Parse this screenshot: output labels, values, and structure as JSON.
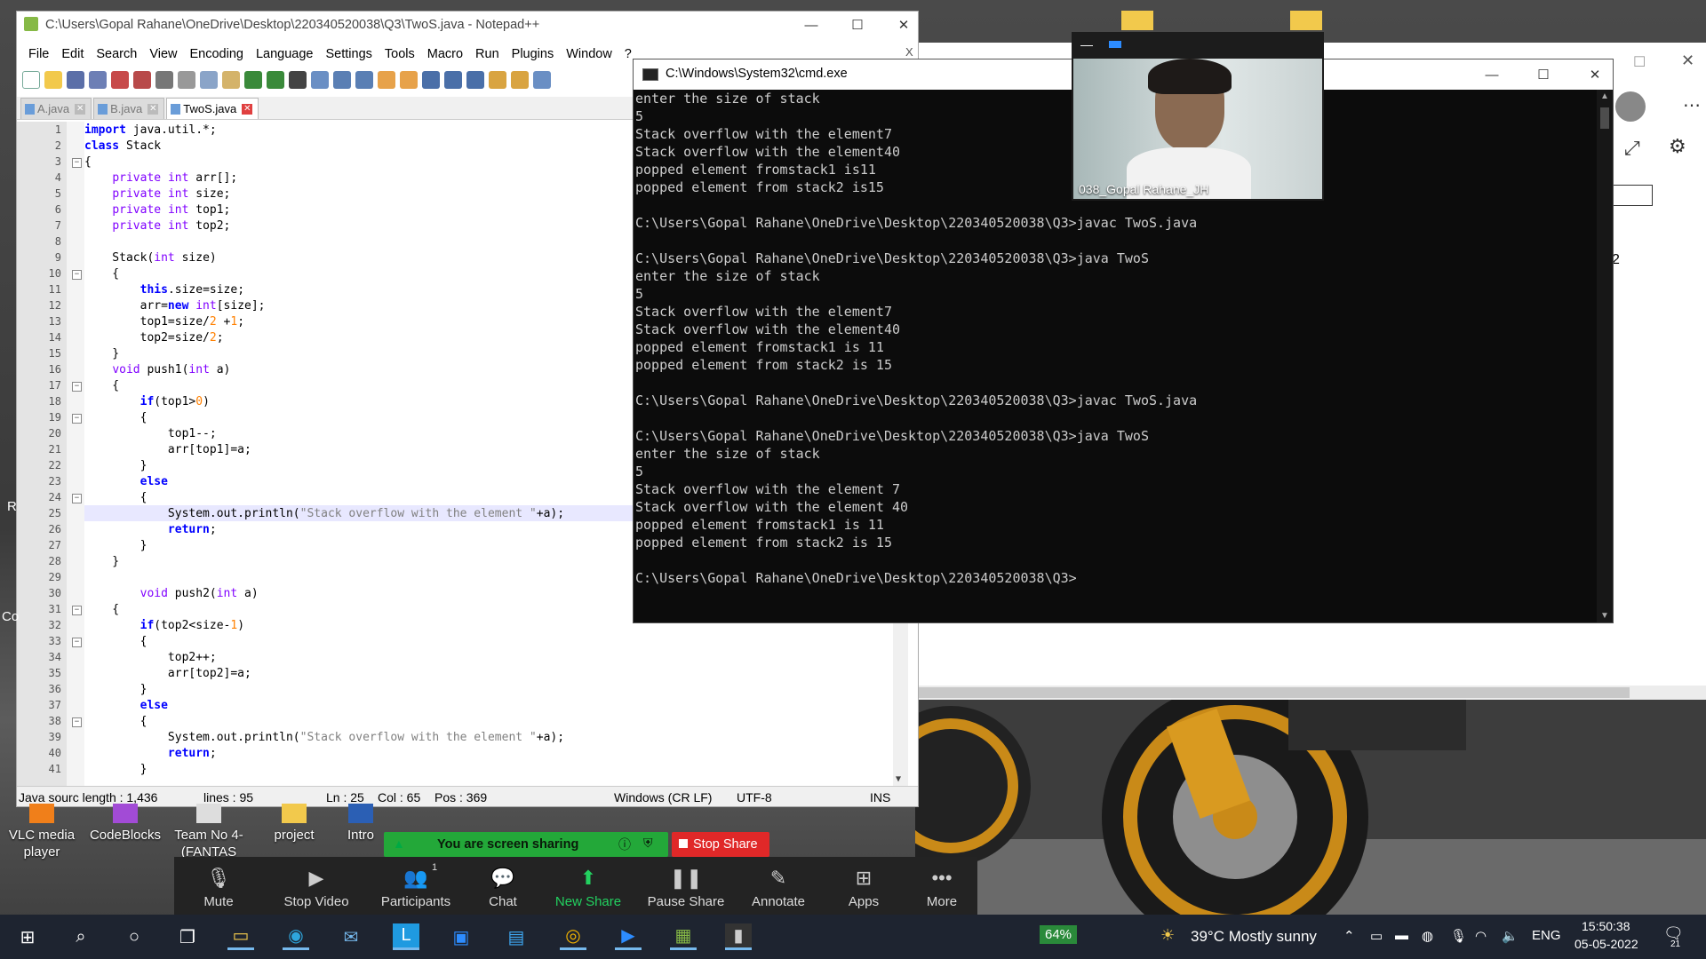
{
  "npp": {
    "title": "C:\\Users\\Gopal Rahane\\OneDrive\\Desktop\\220340520038\\Q3\\TwoS.java - Notepad++",
    "menu": [
      "File",
      "Edit",
      "Search",
      "View",
      "Encoding",
      "Language",
      "Settings",
      "Tools",
      "Macro",
      "Run",
      "Plugins",
      "Window",
      "?"
    ],
    "close_x": "X",
    "tabs": [
      "A.java",
      "B.java",
      "TwoS.java"
    ],
    "lines": [
      {
        "n": "1",
        "html": "<span class='kw'>import</span> java.util.*;"
      },
      {
        "n": "2",
        "html": "<span class='kw'>class</span> Stack"
      },
      {
        "n": "3",
        "html": "{"
      },
      {
        "n": "4",
        "html": "    <span class='ty'>private</span> <span class='ty'>int</span> arr[];"
      },
      {
        "n": "5",
        "html": "    <span class='ty'>private</span> <span class='ty'>int</span> size;"
      },
      {
        "n": "6",
        "html": "    <span class='ty'>private</span> <span class='ty'>int</span> top1;"
      },
      {
        "n": "7",
        "html": "    <span class='ty'>private</span> <span class='ty'>int</span> top2;"
      },
      {
        "n": "8",
        "html": ""
      },
      {
        "n": "9",
        "html": "    Stack(<span class='ty'>int</span> size)"
      },
      {
        "n": "10",
        "html": "    {"
      },
      {
        "n": "11",
        "html": "        <span class='kw'>this</span>.size=size;"
      },
      {
        "n": "12",
        "html": "        arr=<span class='kw'>new</span> <span class='ty'>int</span>[size];"
      },
      {
        "n": "13",
        "html": "        top1=size/<span class='num'>2</span> +<span class='num'>1</span>;"
      },
      {
        "n": "14",
        "html": "        top2=size/<span class='num'>2</span>;"
      },
      {
        "n": "15",
        "html": "    }"
      },
      {
        "n": "16",
        "html": "    <span class='ty'>void</span> push1(<span class='ty'>int</span> a)"
      },
      {
        "n": "17",
        "html": "    {"
      },
      {
        "n": "18",
        "html": "        <span class='kw'>if</span>(top1&gt;<span class='num'>0</span>)"
      },
      {
        "n": "19",
        "html": "        {"
      },
      {
        "n": "20",
        "html": "            top1--;"
      },
      {
        "n": "21",
        "html": "            arr[top1]=a;"
      },
      {
        "n": "22",
        "html": "        }"
      },
      {
        "n": "23",
        "html": "        <span class='kw'>else</span>"
      },
      {
        "n": "24",
        "html": "        {"
      },
      {
        "n": "25",
        "html": "            System.out.println(<span class='str'>\"Stack overflow with the element \"</span>+a);"
      },
      {
        "n": "26",
        "html": "            <span class='kw'>return</span>;"
      },
      {
        "n": "27",
        "html": "        }"
      },
      {
        "n": "28",
        "html": "    }"
      },
      {
        "n": "29",
        "html": ""
      },
      {
        "n": "30",
        "html": "        <span class='ty'>void</span> push2(<span class='ty'>int</span> a)"
      },
      {
        "n": "31",
        "html": "    {"
      },
      {
        "n": "32",
        "html": "        <span class='kw'>if</span>(top2&lt;size-<span class='num'>1</span>)"
      },
      {
        "n": "33",
        "html": "        {"
      },
      {
        "n": "34",
        "html": "            top2++;"
      },
      {
        "n": "35",
        "html": "            arr[top2]=a;"
      },
      {
        "n": "36",
        "html": "        }"
      },
      {
        "n": "37",
        "html": "        <span class='kw'>else</span>"
      },
      {
        "n": "38",
        "html": "        {"
      },
      {
        "n": "39",
        "html": "            System.out.println(<span class='str'>\"Stack overflow with the element \"</span>+a);"
      },
      {
        "n": "40",
        "html": "            <span class='kw'>return</span>;"
      },
      {
        "n": "41",
        "html": "        }"
      }
    ],
    "status": {
      "length": "Java sourc length : 1,436",
      "lines": "lines : 95",
      "ln": "Ln : 25",
      "col": "Col : 65",
      "pos": "Pos : 369",
      "eol": "Windows (CR LF)",
      "enc": "UTF-8",
      "mode": "INS"
    }
  },
  "cmd": {
    "title": "C:\\Windows\\System32\\cmd.exe",
    "output": "enter the size of stack\n5\nStack overflow with the element7\nStack overflow with the element40\npopped element fromstack1 is11\npopped element from stack2 is15\n\nC:\\Users\\Gopal Rahane\\OneDrive\\Desktop\\220340520038\\Q3>javac TwoS.java\n\nC:\\Users\\Gopal Rahane\\OneDrive\\Desktop\\220340520038\\Q3>java TwoS\nenter the size of stack\n5\nStack overflow with the element7\nStack overflow with the element40\npopped element fromstack1 is 11\npopped element from stack2 is 15\n\nC:\\Users\\Gopal Rahane\\OneDrive\\Desktop\\220340520038\\Q3>javac TwoS.java\n\nC:\\Users\\Gopal Rahane\\OneDrive\\Desktop\\220340520038\\Q3>java TwoS\nenter the size of stack\n5\nStack overflow with the element 7\nStack overflow with the element 40\npopped element fromstack1 is 11\npopped element from stack2 is 15\n\nC:\\Users\\Gopal Rahane\\OneDrive\\Desktop\\220340520038\\Q3>"
  },
  "webcam": {
    "name": "038_Gopal Rahane_JH"
  },
  "bgapp": {
    "number": "2"
  },
  "desktop_icons": [
    "VLC media player",
    "CodeBlocks",
    "Team No 4-(FANTAS",
    "project",
    "Intro"
  ],
  "desktop_edge_labels": [
    "R",
    "Co"
  ],
  "zoom": {
    "sharing_text": "You are screen sharing",
    "stop_share": "Stop Share",
    "participants_count": "1",
    "buttons": [
      "Mute",
      "Stop Video",
      "Participants",
      "Chat",
      "New Share",
      "Pause Share",
      "Annotate",
      "Apps",
      "More"
    ]
  },
  "taskbar": {
    "battery": "64%",
    "weather": "39°C  Mostly sunny",
    "lang": "ENG",
    "time": "15:50:38",
    "date": "05-05-2022",
    "notifications": "21"
  },
  "colors": {
    "cmd_bg": "#0c0c0c",
    "zoom_green": "#23a839",
    "zoom_red": "#e02828",
    "taskbar": "#1e2430"
  }
}
